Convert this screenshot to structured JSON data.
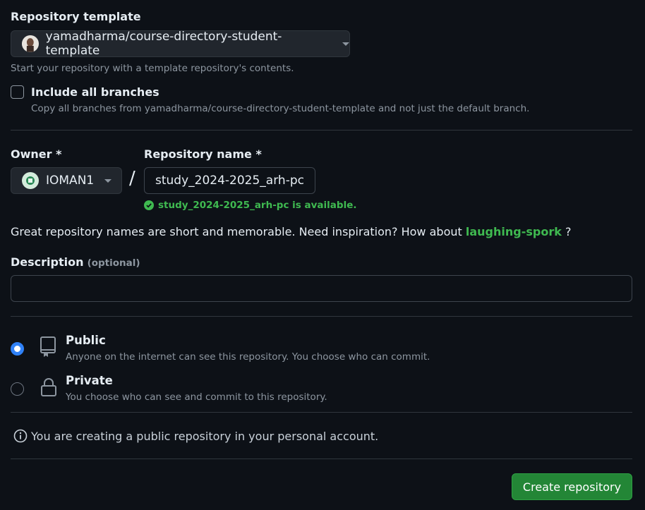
{
  "template": {
    "heading": "Repository template",
    "selected": "yamadharma/course-directory-student-template",
    "hint": "Start your repository with a template repository's contents."
  },
  "branches": {
    "label": "Include all branches",
    "description": "Copy all branches from yamadharma/course-directory-student-template and not just the default branch.",
    "checked": false
  },
  "owner": {
    "label": "Owner *",
    "value": "IOMAN1"
  },
  "separator": "/",
  "repo_name": {
    "label": "Repository name *",
    "value": "study_2024-2025_arh-pc",
    "availability": "study_2024-2025_arh-pc is available."
  },
  "suggestion": {
    "text": "Great repository names are short and memorable. Need inspiration? How about",
    "name": "laughing-spork",
    "suffix": "?"
  },
  "description": {
    "label": "Description",
    "optional": "(optional)",
    "value": ""
  },
  "visibility": {
    "public": {
      "label": "Public",
      "description": "Anyone on the internet can see this repository. You choose who can commit.",
      "selected": true
    },
    "private": {
      "label": "Private",
      "description": "You choose who can see and commit to this repository.",
      "selected": false
    }
  },
  "notice": "You are creating a public repository in your personal account.",
  "submit_label": "Create repository",
  "colors": {
    "background": "#0d1117",
    "accent_green": "#3fb950",
    "button_green": "#238636",
    "radio_blue": "#2f81f7"
  },
  "icons": {
    "template_avatar": "avatar-icon",
    "owner_avatar": "avatar-icon",
    "public": "repo-icon",
    "private": "lock-icon",
    "info": "info-icon",
    "check": "check-circle-icon"
  }
}
